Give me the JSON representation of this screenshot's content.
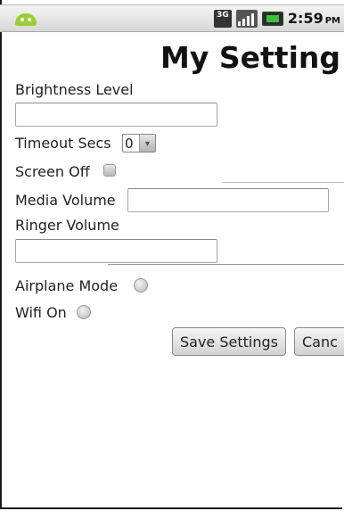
{
  "status_bar": {
    "network": "3G",
    "time": "2:59",
    "ampm": "PM"
  },
  "page": {
    "title": "My Setting"
  },
  "form": {
    "brightness_label": "Brightness Level",
    "brightness_value": "",
    "timeout_label": "Timeout Secs",
    "timeout_value": "0",
    "screen_off_label": "Screen Off",
    "media_volume_label": "Media Volume",
    "media_volume_value": "",
    "ringer_volume_label": "Ringer Volume",
    "ringer_volume_value": "",
    "airplane_mode_label": "Airplane Mode",
    "wifi_label": "Wifi On"
  },
  "buttons": {
    "save_label": "Save Settings",
    "cancel_label": "Canc"
  }
}
